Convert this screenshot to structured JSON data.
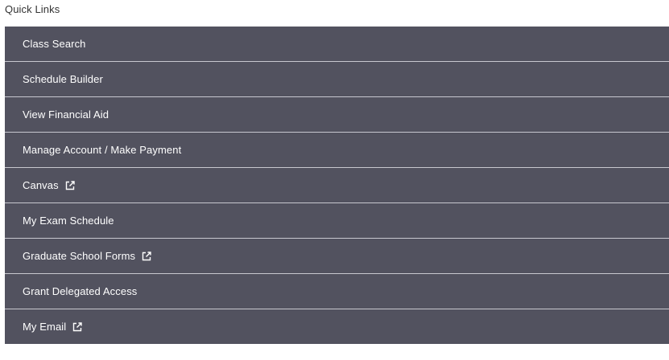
{
  "quick_links": {
    "title": "Quick Links",
    "items": [
      {
        "label": "Class Search",
        "external": false
      },
      {
        "label": "Schedule Builder",
        "external": false
      },
      {
        "label": "View Financial Aid",
        "external": false
      },
      {
        "label": "Manage Account / Make Payment",
        "external": false
      },
      {
        "label": "Canvas",
        "external": true,
        "icon": "external-link-icon"
      },
      {
        "label": "My Exam Schedule",
        "external": false
      },
      {
        "label": "Graduate School Forms",
        "external": true,
        "icon": "external-link-icon"
      },
      {
        "label": "Grant Delegated Access",
        "external": false
      },
      {
        "label": "My Email",
        "external": true,
        "icon": "external-link-icon"
      }
    ]
  },
  "colors": {
    "item_background": "#52525f",
    "item_text": "#ffffff",
    "divider": "#c8c8cf",
    "title_text": "#333333"
  }
}
